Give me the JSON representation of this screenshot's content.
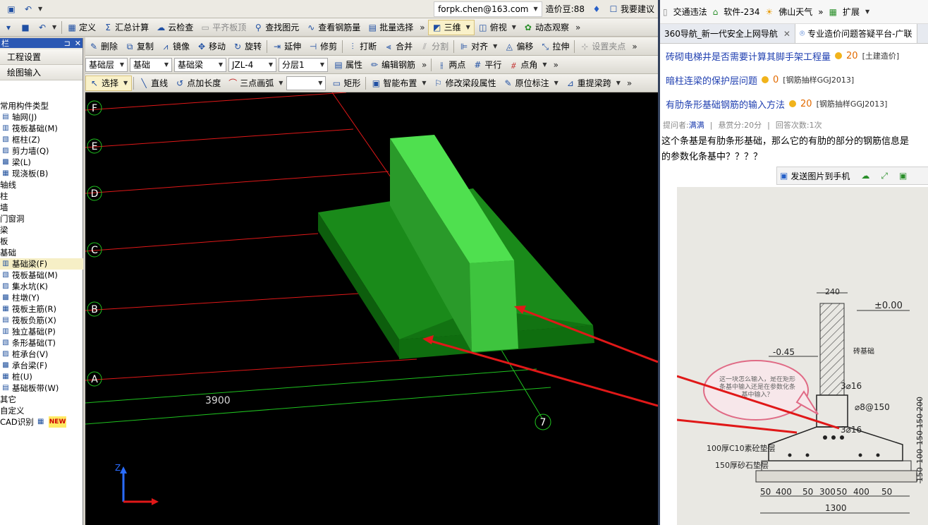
{
  "top": {
    "email": "forpk.chen@163.com",
    "credit": "造价豆:88",
    "suggest": "我要建议"
  },
  "toolbar1": {
    "items": [
      "定义",
      "汇总计算",
      "云检查",
      "平齐板顶",
      "查找图元",
      "查看钢筋量",
      "批量选择",
      "三维",
      "俯视",
      "动态观察"
    ]
  },
  "toolbar2": {
    "items": [
      "删除",
      "复制",
      "镜像",
      "移动",
      "旋转",
      "延伸",
      "修剪",
      "打断",
      "合并",
      "分割",
      "对齐",
      "偏移",
      "拉伸",
      "设置夹点"
    ]
  },
  "toolbar3": {
    "selects": [
      "基础层",
      "基础",
      "基础梁",
      "JZL-4",
      "分层1"
    ],
    "items": [
      "属性",
      "编辑钢筋",
      "两点",
      "平行",
      "点角"
    ]
  },
  "toolbar4": {
    "items": [
      "选择",
      "直线",
      "点加长度",
      "三点画弧",
      "矩形",
      "智能布置",
      "修改梁段属性",
      "原位标注",
      "重提梁跨"
    ]
  },
  "left": {
    "header": "栏",
    "buttons": [
      "工程设置",
      "绘图输入"
    ],
    "tree": [
      {
        "label": "常用构件类型",
        "child": false
      },
      {
        "label": "轴网(J)",
        "child": true
      },
      {
        "label": "筏板基础(M)",
        "child": true
      },
      {
        "label": "框柱(Z)",
        "child": true
      },
      {
        "label": "剪力墙(Q)",
        "child": true
      },
      {
        "label": "梁(L)",
        "child": true
      },
      {
        "label": "现浇板(B)",
        "child": true
      },
      {
        "label": "轴线",
        "child": false
      },
      {
        "label": "柱",
        "child": false
      },
      {
        "label": "墙",
        "child": false
      },
      {
        "label": "门窗洞",
        "child": false
      },
      {
        "label": "梁",
        "child": false
      },
      {
        "label": "板",
        "child": false
      },
      {
        "label": "基础",
        "child": false
      },
      {
        "label": "基础梁(F)",
        "child": true,
        "selected": true
      },
      {
        "label": "筏板基础(M)",
        "child": true
      },
      {
        "label": "集水坑(K)",
        "child": true
      },
      {
        "label": "柱墩(Y)",
        "child": true
      },
      {
        "label": "筏板主筋(R)",
        "child": true
      },
      {
        "label": "筏板负筋(X)",
        "child": true
      },
      {
        "label": "独立基础(P)",
        "child": true
      },
      {
        "label": "条形基础(T)",
        "child": true
      },
      {
        "label": "桩承台(V)",
        "child": true
      },
      {
        "label": "承台梁(F)",
        "child": true
      },
      {
        "label": "桩(U)",
        "child": true
      },
      {
        "label": "基础板带(W)",
        "child": true
      },
      {
        "label": "其它",
        "child": false
      },
      {
        "label": "自定义",
        "child": false
      },
      {
        "label": "CAD识别",
        "child": false,
        "badge": "NEW"
      }
    ]
  },
  "viewport": {
    "axes": [
      "F",
      "E",
      "D",
      "C",
      "B",
      "A"
    ],
    "col_axis": "7",
    "dimension": "3900",
    "z_label": "Z"
  },
  "browser": {
    "bookmarks": [
      "交通违法",
      "软件-234",
      "佛山天气",
      "扩展"
    ],
    "tabs": [
      "360导航_新一代安全上网导航",
      "专业造价问题答疑平台-广联"
    ],
    "questions": [
      {
        "title": "砖砌电梯井是否需要计算其脚手架工程量",
        "score": "20",
        "cat": "[土建造价]"
      },
      {
        "title": "暗柱连梁的保护层问题",
        "score": "0",
        "cat": "[钢筋抽样GGJ2013]"
      },
      {
        "title": "有肋条形基础钢筋的输入方法",
        "score": "20",
        "cat": "[钢筋抽样GGJ2013]"
      }
    ],
    "meta": {
      "asker_label": "提问者:",
      "asker": "满满",
      "bounty": "悬赏分:20分",
      "answers": "回答次数:1次"
    },
    "content_line1": "这个条基是有肋条形基础，那么它的有肋的部分的钢筋信息是",
    "content_line2": "的参数化条基中？？？？",
    "send_btn": "发送图片到手机",
    "drawing": {
      "top_dim": "240",
      "elev_top": "±0.00",
      "elev_bot": "-0.45",
      "brick_label": "砖基础",
      "bubble": "这一块怎么输入，是在矩形条基中输入还是在参数化条基中输入？",
      "rebar1": "3⌀16",
      "rebar2": "⌀8@150",
      "rebar3": "3⌀16",
      "pad1": "100厚C10素砼垫层",
      "pad2": "150厚砂石垫层",
      "dims_bottom": [
        "50",
        "400",
        "50",
        "300",
        "50",
        "400",
        "50"
      ],
      "total": "1300",
      "dims_right": [
        "200",
        "150",
        "150",
        "100",
        "150"
      ]
    }
  }
}
